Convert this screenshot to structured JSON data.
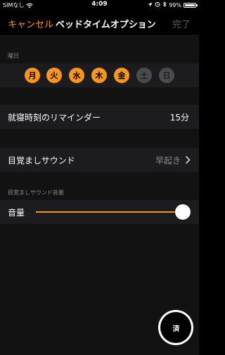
{
  "status_bar": {
    "carrier": "SIMなし",
    "time": "4:09",
    "battery": "99%"
  },
  "nav": {
    "cancel": "キャンセル",
    "title": "ベッドタイムオプション",
    "done": "完了"
  },
  "days": {
    "header": "曜日",
    "items": [
      {
        "label": "月",
        "selected": true
      },
      {
        "label": "火",
        "selected": true
      },
      {
        "label": "水",
        "selected": true
      },
      {
        "label": "木",
        "selected": true
      },
      {
        "label": "金",
        "selected": true
      },
      {
        "label": "土",
        "selected": false
      },
      {
        "label": "日",
        "selected": false
      }
    ]
  },
  "reminder": {
    "label": "就寝時刻のリマインダー",
    "value": "15分"
  },
  "wake_sound": {
    "label": "目覚ましサウンド",
    "value": "早起き"
  },
  "volume": {
    "header": "目覚ましサウンド音量",
    "label": "音量",
    "level": 1.0
  },
  "watermark": {
    "text": "済"
  },
  "colors": {
    "accent": "#f7951d",
    "background": "#121212",
    "cell": "#1c1c1e"
  }
}
